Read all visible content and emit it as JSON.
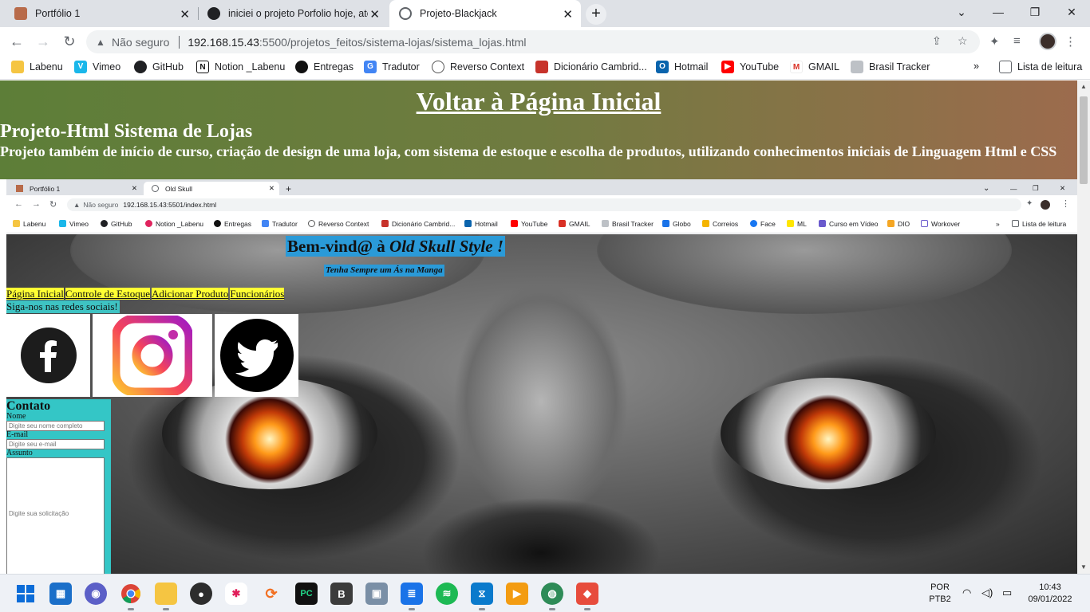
{
  "browser": {
    "tabs": [
      {
        "title": "Portfólio 1",
        "active": false
      },
      {
        "title": "iniciei o projeto Porfolio hoje, até",
        "active": false
      },
      {
        "title": "Projeto-Blackjack",
        "active": true
      }
    ],
    "address": {
      "security": "Não seguro",
      "host": "192.168.15.43",
      "path": ":5500/projetos_feitos/sistema-lojas/sistema_lojas.html"
    },
    "bookmarks": [
      "Labenu",
      "Vimeo",
      "GitHub",
      "Notion _Labenu",
      "Entregas",
      "Tradutor",
      "Reverso Context",
      "Dicionário Cambrid...",
      "Hotmail",
      "YouTube",
      "GMAIL",
      "Brasil Tracker"
    ],
    "reading_list": "Lista de leitura",
    "more": "»"
  },
  "page": {
    "back_link": "Voltar à Página Inicial",
    "title": "Projeto-Html Sistema de Lojas",
    "description": "Projeto também de início de curso, criação de design de uma loja, com sistema de estoque e escolha de produtos, utilizando conhecimentos iniciais de Linguagem Html e CSS"
  },
  "screenshot": {
    "tabs": [
      "Portfólio 1",
      "Old Skull"
    ],
    "security": "Não seguro",
    "url": "192.168.15.43:5501/index.html",
    "bookmarks": [
      "Labenu",
      "Vimeo",
      "GitHub",
      "Notion _Labenu",
      "Entregas",
      "Tradutor",
      "Reverso Context",
      "Dicionário Cambrid...",
      "Hotmail",
      "YouTube",
      "GMAIL",
      "Brasil Tracker",
      "Globo",
      "Correios",
      "Face",
      "ML",
      "Curso em Vídeo",
      "DIO",
      "Workover"
    ],
    "reading_list": "Lista de leitura",
    "welcome_prefix": "Bem-vind@ à ",
    "welcome_em": "Old Skull Style !",
    "tagline": "Tenha Sempre um Ás na Manga",
    "menu": [
      "Página Inicial",
      "Controle de Estoque",
      "Adicionar Produto",
      "Funcionários"
    ],
    "follow": "Siga-nos nas redes sociais!",
    "contact": {
      "heading": "Contato",
      "name_label": "Nome",
      "name_placeholder": "Digite seu nome completo",
      "email_label": "E-mail",
      "email_placeholder": "Digite seu e-mail",
      "subject_label": "Assunto",
      "subject_placeholder": "Digite sua solicitação"
    }
  },
  "taskbar": {
    "lang": "POR",
    "layout": "PTB2",
    "time": "10:43",
    "date": "09/01/2022",
    "pinned": [
      "windows-start",
      "widgets",
      "teams",
      "chrome",
      "file-explorer",
      "media-player",
      "slack",
      "git-kraken",
      "pycharm",
      "b-app",
      "photo-app",
      "notepad",
      "spotify",
      "vscode",
      "video-editor",
      "globe-app",
      "git-app"
    ]
  },
  "colors": {
    "header_start": "#5d7e38",
    "header_end": "#9c6b4d",
    "welcome_bg": "#2a9ad8",
    "menu_bg": "#ffff33",
    "contact_bg": "#34c6c6"
  }
}
